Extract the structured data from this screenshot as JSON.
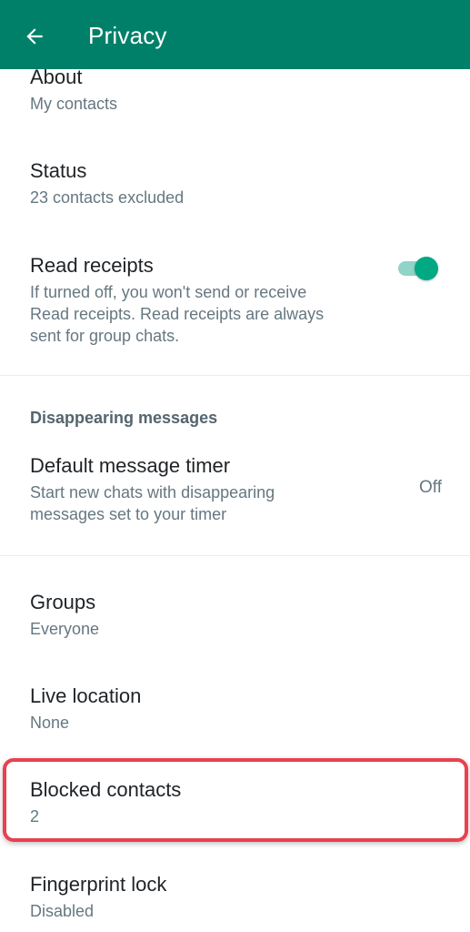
{
  "header": {
    "title": "Privacy",
    "back_icon": "arrow-left-icon",
    "background_color": "#008069"
  },
  "items": {
    "about": {
      "title": "About",
      "subtitle": "My contacts"
    },
    "status": {
      "title": "Status",
      "subtitle": "23 contacts excluded"
    },
    "read_receipts": {
      "title": "Read receipts",
      "subtitle_lines": [
        "If turned off, you won't send or receive",
        "Read receipts. Read receipts are always",
        "sent for group chats."
      ],
      "toggle_on": true,
      "toggle_color": "#00a884"
    },
    "disappearing_section": {
      "header": "Disappearing messages"
    },
    "default_timer": {
      "title": "Default message timer",
      "subtitle_lines": [
        "Start new chats with disappearing",
        "messages set to your timer"
      ],
      "value": "Off"
    },
    "groups": {
      "title": "Groups",
      "subtitle": "Everyone"
    },
    "live_location": {
      "title": "Live location",
      "subtitle": "None"
    },
    "blocked_contacts": {
      "title": "Blocked contacts",
      "subtitle": "2",
      "highlight_color": "#e8414f"
    },
    "fingerprint_lock": {
      "title": "Fingerprint lock",
      "subtitle": "Disabled"
    }
  }
}
